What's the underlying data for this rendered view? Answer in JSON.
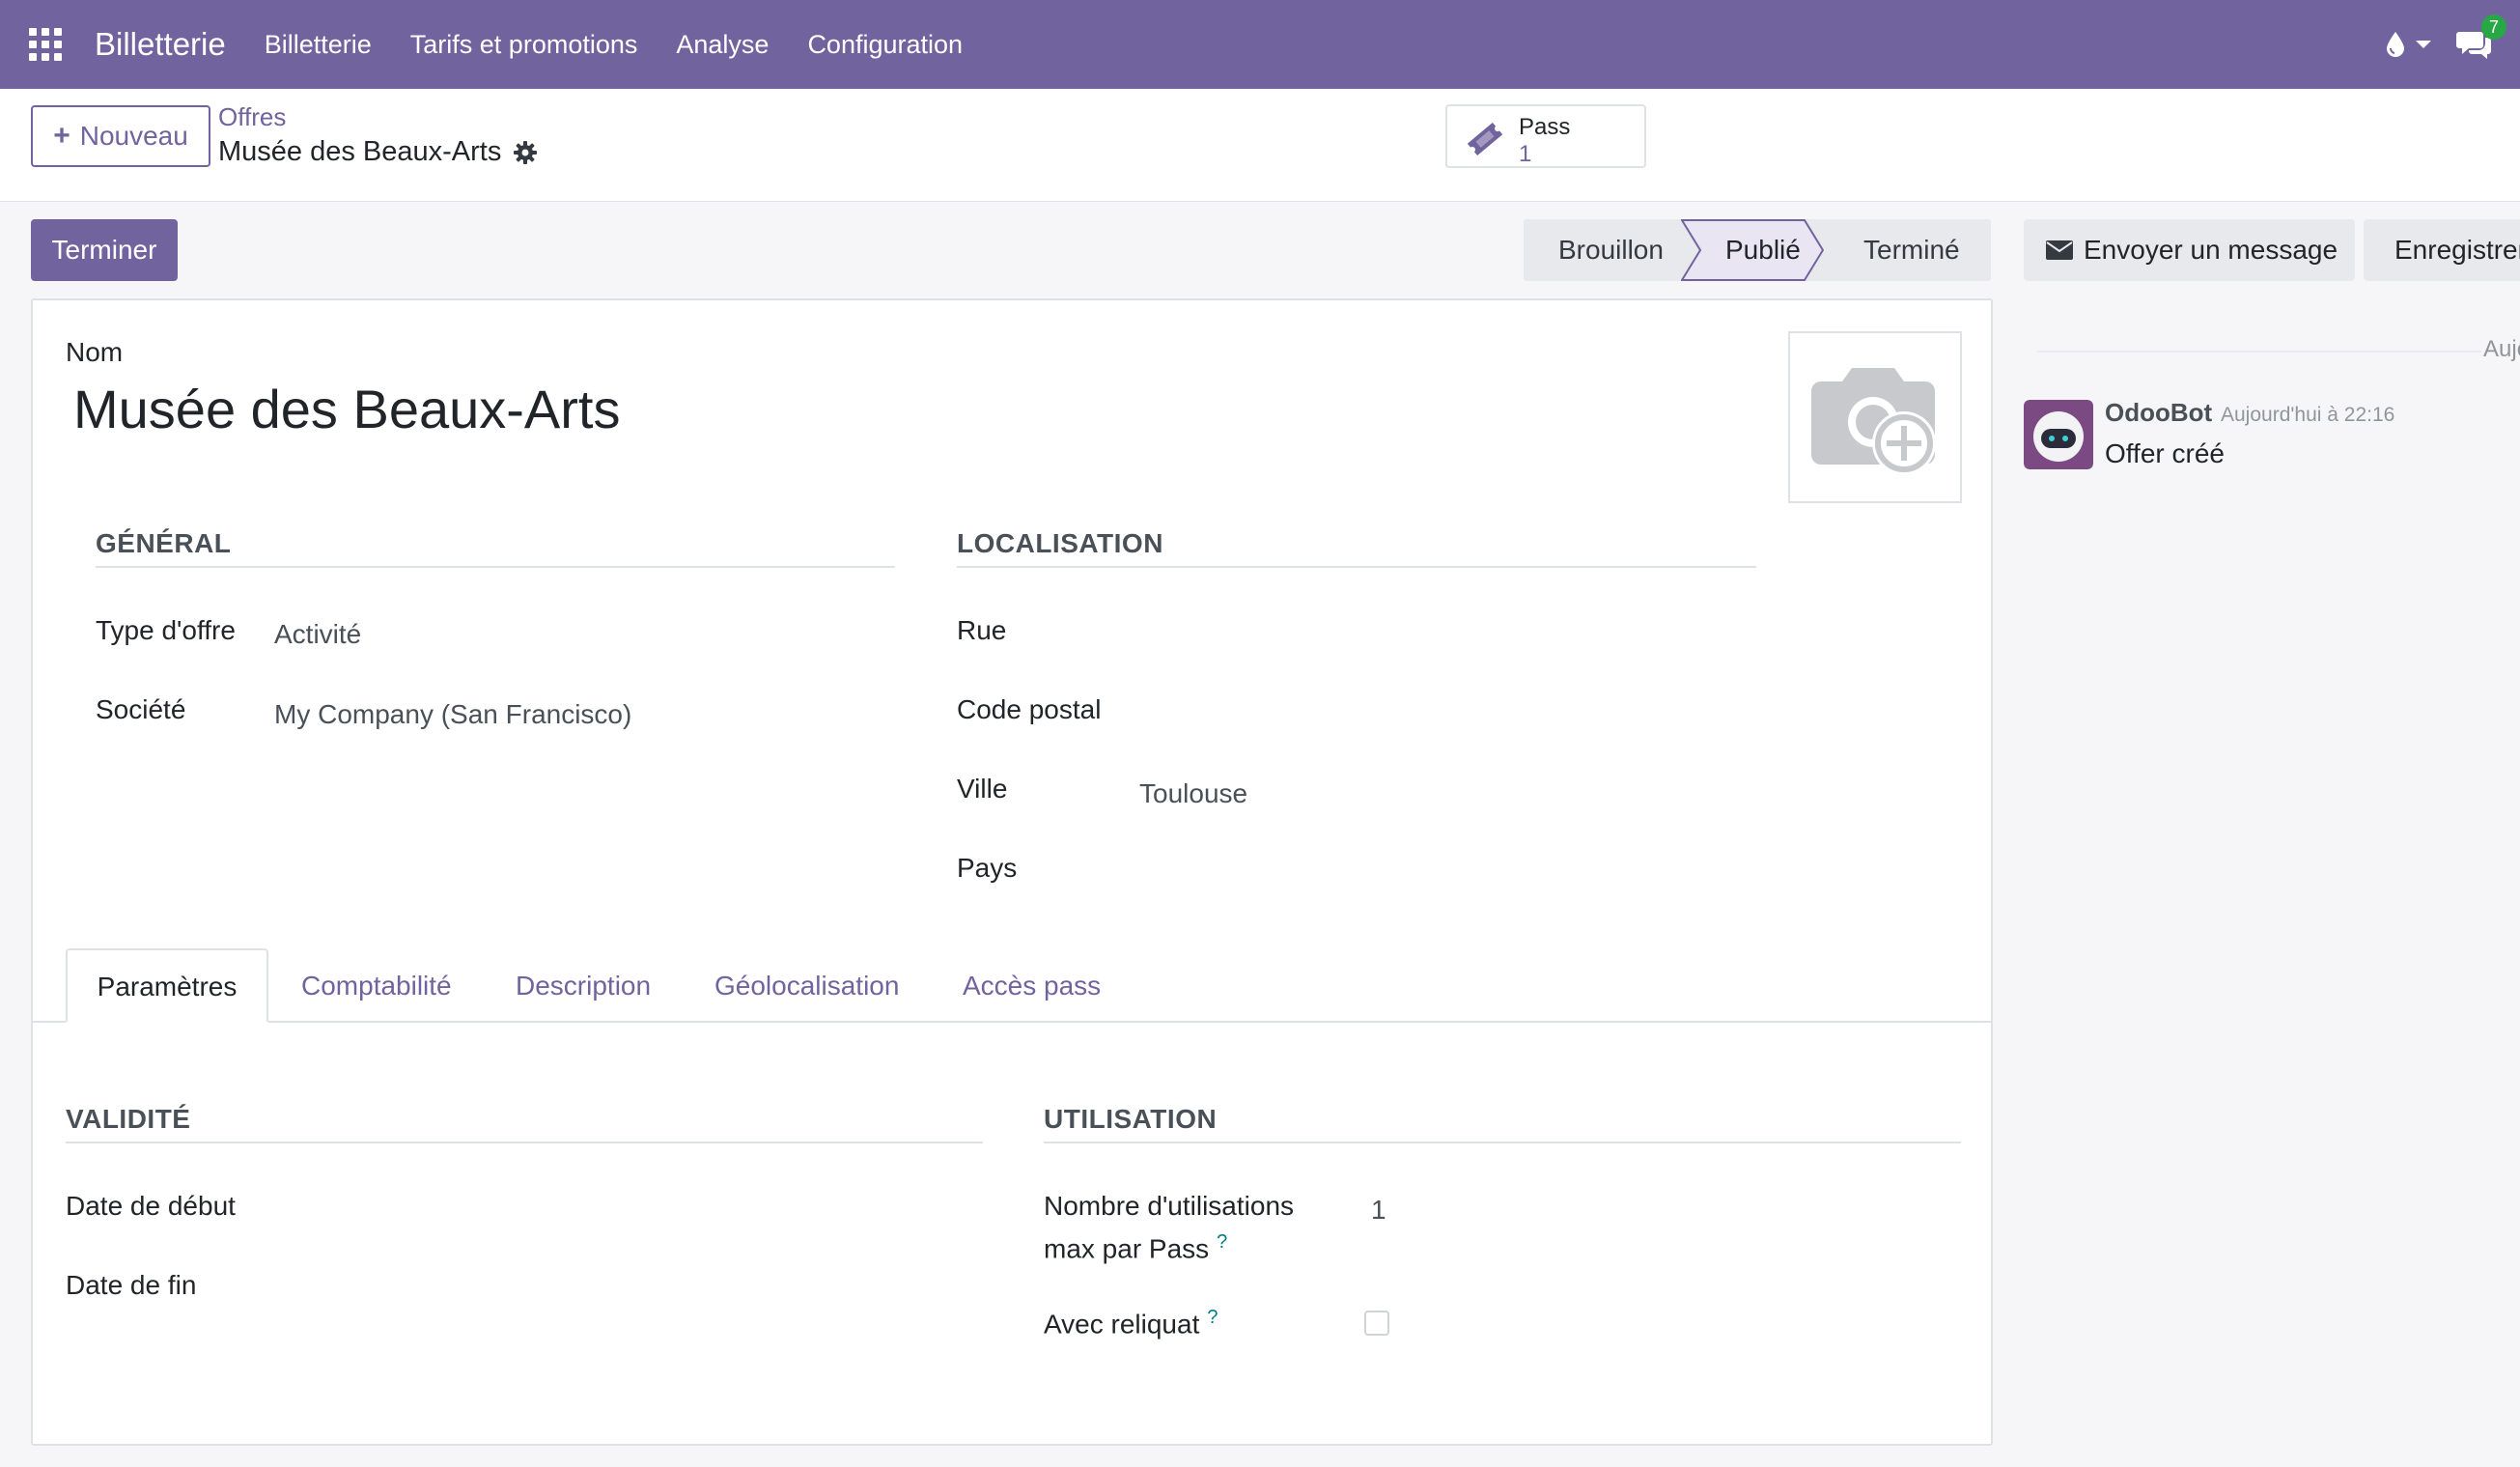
{
  "navbar": {
    "brand": "Billetterie",
    "menu": [
      "Billetterie",
      "Tarifs et promotions",
      "Analyse",
      "Configuration"
    ],
    "chat_badge": "7",
    "color": "#71639e"
  },
  "control": {
    "new_label": "Nouveau",
    "breadcrumb_parent": "Offres",
    "breadcrumb_current": "Musée des Beaux-Arts",
    "smart_button": {
      "label": "Pass",
      "value": "1"
    }
  },
  "actions": {
    "terminer": "Terminer",
    "send_message": "Envoyer un message",
    "log_note": "Enregistrer une note"
  },
  "statusbar": {
    "stages": [
      "Brouillon",
      "Publié",
      "Terminé"
    ],
    "active": "Publié"
  },
  "form": {
    "name_label": "Nom",
    "name": "Musée des Beaux-Arts",
    "general": {
      "title": "GÉNÉRAL",
      "type_label": "Type d'offre",
      "type_value": "Activité",
      "company_label": "Société",
      "company_value": "My Company (San Francisco)"
    },
    "location": {
      "title": "LOCALISATION",
      "street_label": "Rue",
      "zip_label": "Code postal",
      "city_label": "Ville",
      "city_value": "Toulouse",
      "country_label": "Pays"
    },
    "tabs": [
      "Paramètres",
      "Comptabilité",
      "Description",
      "Géolocalisation",
      "Accès pass"
    ],
    "active_tab": "Paramètres",
    "validity": {
      "title": "VALIDITÉ",
      "start_label": "Date de début",
      "end_label": "Date de fin"
    },
    "usage": {
      "title": "UTILISATION",
      "max_label_line1": "Nombre d'utilisations",
      "max_label_line2": "max par Pass",
      "max_value": "1",
      "remainder_label": "Avec reliquat",
      "help": "?"
    }
  },
  "chatter": {
    "date_separator": "Aujourd'hui",
    "author": "OdooBot",
    "time": "Aujourd'hui à 22:16",
    "body": "Offer créé"
  }
}
